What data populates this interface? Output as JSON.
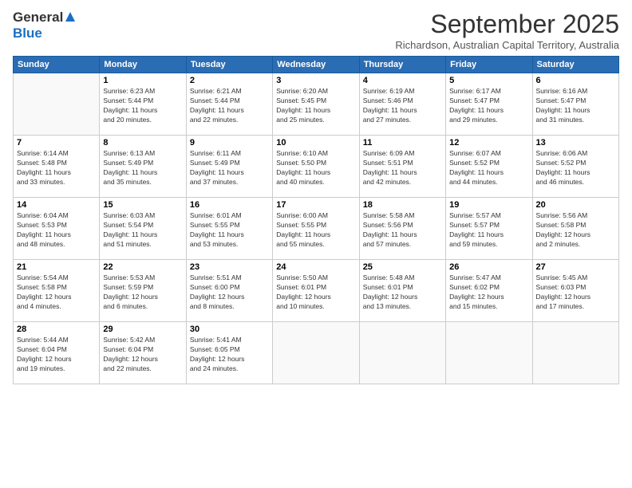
{
  "header": {
    "logo_general": "General",
    "logo_blue": "Blue",
    "month_title": "September 2025",
    "subtitle": "Richardson, Australian Capital Territory, Australia"
  },
  "weekdays": [
    "Sunday",
    "Monday",
    "Tuesday",
    "Wednesday",
    "Thursday",
    "Friday",
    "Saturday"
  ],
  "weeks": [
    [
      {
        "day": "",
        "info": ""
      },
      {
        "day": "1",
        "info": "Sunrise: 6:23 AM\nSunset: 5:44 PM\nDaylight: 11 hours\nand 20 minutes."
      },
      {
        "day": "2",
        "info": "Sunrise: 6:21 AM\nSunset: 5:44 PM\nDaylight: 11 hours\nand 22 minutes."
      },
      {
        "day": "3",
        "info": "Sunrise: 6:20 AM\nSunset: 5:45 PM\nDaylight: 11 hours\nand 25 minutes."
      },
      {
        "day": "4",
        "info": "Sunrise: 6:19 AM\nSunset: 5:46 PM\nDaylight: 11 hours\nand 27 minutes."
      },
      {
        "day": "5",
        "info": "Sunrise: 6:17 AM\nSunset: 5:47 PM\nDaylight: 11 hours\nand 29 minutes."
      },
      {
        "day": "6",
        "info": "Sunrise: 6:16 AM\nSunset: 5:47 PM\nDaylight: 11 hours\nand 31 minutes."
      }
    ],
    [
      {
        "day": "7",
        "info": "Sunrise: 6:14 AM\nSunset: 5:48 PM\nDaylight: 11 hours\nand 33 minutes."
      },
      {
        "day": "8",
        "info": "Sunrise: 6:13 AM\nSunset: 5:49 PM\nDaylight: 11 hours\nand 35 minutes."
      },
      {
        "day": "9",
        "info": "Sunrise: 6:11 AM\nSunset: 5:49 PM\nDaylight: 11 hours\nand 37 minutes."
      },
      {
        "day": "10",
        "info": "Sunrise: 6:10 AM\nSunset: 5:50 PM\nDaylight: 11 hours\nand 40 minutes."
      },
      {
        "day": "11",
        "info": "Sunrise: 6:09 AM\nSunset: 5:51 PM\nDaylight: 11 hours\nand 42 minutes."
      },
      {
        "day": "12",
        "info": "Sunrise: 6:07 AM\nSunset: 5:52 PM\nDaylight: 11 hours\nand 44 minutes."
      },
      {
        "day": "13",
        "info": "Sunrise: 6:06 AM\nSunset: 5:52 PM\nDaylight: 11 hours\nand 46 minutes."
      }
    ],
    [
      {
        "day": "14",
        "info": "Sunrise: 6:04 AM\nSunset: 5:53 PM\nDaylight: 11 hours\nand 48 minutes."
      },
      {
        "day": "15",
        "info": "Sunrise: 6:03 AM\nSunset: 5:54 PM\nDaylight: 11 hours\nand 51 minutes."
      },
      {
        "day": "16",
        "info": "Sunrise: 6:01 AM\nSunset: 5:55 PM\nDaylight: 11 hours\nand 53 minutes."
      },
      {
        "day": "17",
        "info": "Sunrise: 6:00 AM\nSunset: 5:55 PM\nDaylight: 11 hours\nand 55 minutes."
      },
      {
        "day": "18",
        "info": "Sunrise: 5:58 AM\nSunset: 5:56 PM\nDaylight: 11 hours\nand 57 minutes."
      },
      {
        "day": "19",
        "info": "Sunrise: 5:57 AM\nSunset: 5:57 PM\nDaylight: 11 hours\nand 59 minutes."
      },
      {
        "day": "20",
        "info": "Sunrise: 5:56 AM\nSunset: 5:58 PM\nDaylight: 12 hours\nand 2 minutes."
      }
    ],
    [
      {
        "day": "21",
        "info": "Sunrise: 5:54 AM\nSunset: 5:58 PM\nDaylight: 12 hours\nand 4 minutes."
      },
      {
        "day": "22",
        "info": "Sunrise: 5:53 AM\nSunset: 5:59 PM\nDaylight: 12 hours\nand 6 minutes."
      },
      {
        "day": "23",
        "info": "Sunrise: 5:51 AM\nSunset: 6:00 PM\nDaylight: 12 hours\nand 8 minutes."
      },
      {
        "day": "24",
        "info": "Sunrise: 5:50 AM\nSunset: 6:01 PM\nDaylight: 12 hours\nand 10 minutes."
      },
      {
        "day": "25",
        "info": "Sunrise: 5:48 AM\nSunset: 6:01 PM\nDaylight: 12 hours\nand 13 minutes."
      },
      {
        "day": "26",
        "info": "Sunrise: 5:47 AM\nSunset: 6:02 PM\nDaylight: 12 hours\nand 15 minutes."
      },
      {
        "day": "27",
        "info": "Sunrise: 5:45 AM\nSunset: 6:03 PM\nDaylight: 12 hours\nand 17 minutes."
      }
    ],
    [
      {
        "day": "28",
        "info": "Sunrise: 5:44 AM\nSunset: 6:04 PM\nDaylight: 12 hours\nand 19 minutes."
      },
      {
        "day": "29",
        "info": "Sunrise: 5:42 AM\nSunset: 6:04 PM\nDaylight: 12 hours\nand 22 minutes."
      },
      {
        "day": "30",
        "info": "Sunrise: 5:41 AM\nSunset: 6:05 PM\nDaylight: 12 hours\nand 24 minutes."
      },
      {
        "day": "",
        "info": ""
      },
      {
        "day": "",
        "info": ""
      },
      {
        "day": "",
        "info": ""
      },
      {
        "day": "",
        "info": ""
      }
    ]
  ]
}
